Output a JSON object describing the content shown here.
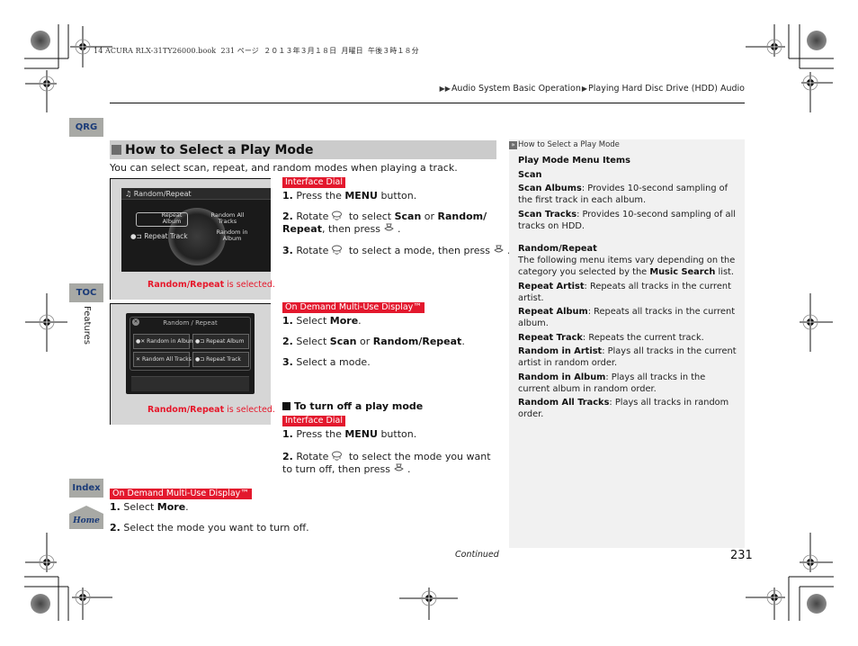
{
  "print_header": "14 ACURA RLX-31TY26000.book  231 ページ  ２０１３年３月１８日  月曜日  午後３時１８分",
  "breadcrumb": {
    "items": [
      "Audio System Basic Operation",
      "Playing Hard Disc Drive (HDD) Audio"
    ]
  },
  "nav": {
    "qrg": "QRG",
    "toc": "TOC",
    "index": "Index",
    "home": "Home",
    "section_label": "Features"
  },
  "section": {
    "title": "How to Select a Play Mode",
    "intro": "You can select scan, repeat, and random modes when playing a track."
  },
  "figures": [
    {
      "screen_title": "Random/Repeat",
      "items": [
        "Repeat Album",
        "Random All Tracks",
        "Repeat Track",
        "Random in Album"
      ],
      "caption_bold": "Random/Repeat",
      "caption_rest": " is selected."
    },
    {
      "screen_title": "Random / Repeat",
      "items": [
        "Random in Album",
        "Repeat Album",
        "Random All Tracks",
        "Repeat Track"
      ],
      "caption_bold": "Random/Repeat",
      "caption_rest": " is selected."
    }
  ],
  "block_dial": {
    "label": "Interface Dial",
    "steps": [
      {
        "num": "1.",
        "pre": " Press the ",
        "bold": "MENU",
        "post": " button."
      },
      {
        "num": "2.",
        "pre": " Rotate",
        "mid1": " to select ",
        "bold1": "Scan",
        "mid2": " or ",
        "bold2": "Random/ Repeat",
        "post": ", then press"
      },
      {
        "num": "3.",
        "pre": " Rotate",
        "mid": " to select a mode, then press"
      }
    ]
  },
  "block_odmd": {
    "label": "On Demand Multi-Use Display™",
    "steps": [
      {
        "num": "1.",
        "pre": " Select ",
        "bold": "More",
        "post": "."
      },
      {
        "num": "2.",
        "pre": " Select ",
        "bold1": "Scan",
        "mid": " or ",
        "bold2": "Random/Repeat",
        "post": "."
      },
      {
        "num": "3.",
        "pre": " Select a mode."
      }
    ]
  },
  "turn_off": {
    "title": "To turn off a play mode",
    "dial_label": "Interface Dial",
    "dial_steps": [
      {
        "num": "1.",
        "pre": " Press the ",
        "bold": "MENU",
        "post": " button."
      },
      {
        "num": "2.",
        "pre": " Rotate",
        "mid": " to select the mode you want to turn off, then press"
      }
    ],
    "odmd_label": "On Demand Multi-Use Display™",
    "odmd_steps": [
      {
        "num": "1.",
        "pre": " Select ",
        "bold": "More",
        "post": "."
      },
      {
        "num": "2.",
        "pre": " Select the mode you want to turn off."
      }
    ]
  },
  "sidebar": {
    "title": "How to Select a Play Mode",
    "heading": "Play Mode Menu Items",
    "scan_heading": "Scan",
    "scan_items": [
      {
        "term": "Scan Albums",
        "desc": ": Provides 10-second sampling of the first track in each album."
      },
      {
        "term": "Scan Tracks",
        "desc": ": Provides 10-second sampling of all tracks on HDD."
      }
    ],
    "rr_heading": "Random/Repeat",
    "rr_intro_pre": "The following menu items vary depending on the category you selected by the ",
    "rr_intro_bold": "Music Search",
    "rr_intro_post": " list.",
    "rr_items": [
      {
        "term": "Repeat Artist",
        "desc": ": Repeats all tracks in the current artist."
      },
      {
        "term": "Repeat Album",
        "desc": ": Repeats all tracks in the current album."
      },
      {
        "term": "Repeat Track",
        "desc": ": Repeats the current track."
      },
      {
        "term": "Random in Artist",
        "desc": ": Plays all tracks in the current artist in random order."
      },
      {
        "term": "Random in Album",
        "desc": ": Plays all tracks in the current album in random order."
      },
      {
        "term": "Random All Tracks",
        "desc": ": Plays all tracks in random order."
      }
    ]
  },
  "footer": {
    "continued": "Continued",
    "page_number": "231"
  },
  "colors": {
    "label_red": "#e3182d",
    "nav_tab_bg": "#a8a9a5",
    "nav_tab_text": "#1b3b78",
    "section_head_bg": "#cbcbcb",
    "sidebar_bg": "#f1f1f1"
  }
}
